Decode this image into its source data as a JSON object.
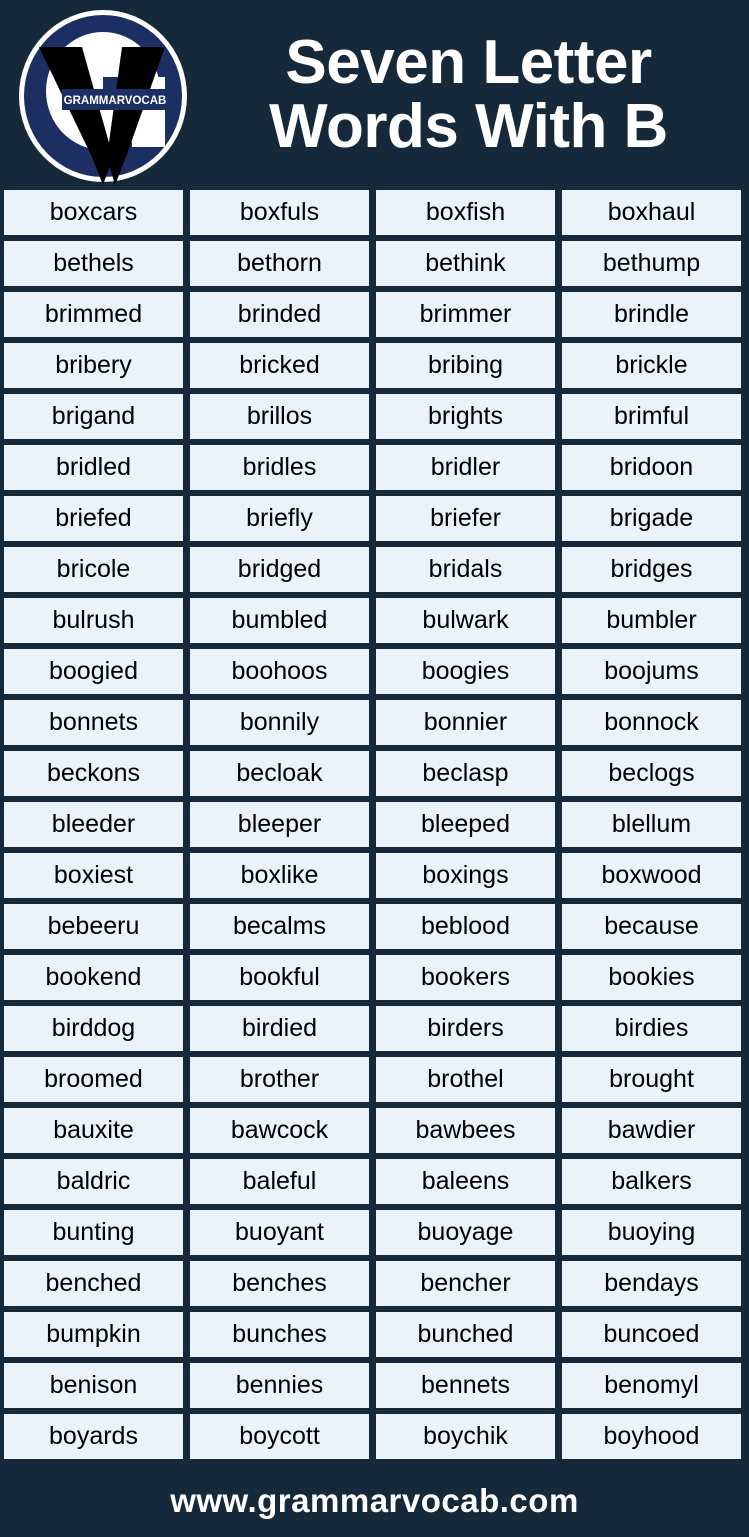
{
  "header": {
    "title_line1": "Seven Letter",
    "title_line2": "Words With B",
    "logo": {
      "brand_text": "GRAMMARVOCAB",
      "letter_g": "G",
      "letter_v": "V"
    }
  },
  "colors": {
    "background": "#16293a",
    "cell_background": "#e9f3f9",
    "cell_text": "#000000",
    "title_text": "#ffffff",
    "logo_navy": "#1b2f63",
    "logo_black": "#000000",
    "logo_white": "#ffffff",
    "footer_text": "#ffffff"
  },
  "footer": {
    "website": "www.grammarvocab.com"
  },
  "grid": {
    "columns": 4,
    "rows": [
      [
        "boxcars",
        "boxfuls",
        "boxfish",
        "boxhaul"
      ],
      [
        "bethels",
        "bethorn",
        "bethink",
        "bethump"
      ],
      [
        "brimmed",
        "brinded",
        "brimmer",
        "brindle"
      ],
      [
        "bribery",
        "bricked",
        "bribing",
        "brickle"
      ],
      [
        "brigand",
        "brillos",
        "brights",
        "brimful"
      ],
      [
        "bridled",
        "bridles",
        "bridler",
        "bridoon"
      ],
      [
        "briefed",
        "briefly",
        "briefer",
        "brigade"
      ],
      [
        "bricole",
        "bridged",
        "bridals",
        "bridges"
      ],
      [
        "bulrush",
        "bumbled",
        "bulwark",
        "bumbler"
      ],
      [
        "boogied",
        "boohoos",
        "boogies",
        "boojums"
      ],
      [
        "bonnets",
        "bonnily",
        "bonnier",
        "bonnock"
      ],
      [
        "beckons",
        "becloak",
        "beclasp",
        "beclogs"
      ],
      [
        "bleeder",
        "bleeper",
        "bleeped",
        "blellum"
      ],
      [
        "boxiest",
        "boxlike",
        "boxings",
        "boxwood"
      ],
      [
        "bebeeru",
        "becalms",
        "beblood",
        "because"
      ],
      [
        "bookend",
        "bookful",
        "bookers",
        "bookies"
      ],
      [
        "birddog",
        "birdied",
        "birders",
        "birdies"
      ],
      [
        "broomed",
        "brother",
        "brothel",
        "brought"
      ],
      [
        "bauxite",
        "bawcock",
        "bawbees",
        "bawdier"
      ],
      [
        "baldric",
        "baleful",
        "baleens",
        "balkers"
      ],
      [
        "bunting",
        "buoyant",
        "buoyage",
        "buoying"
      ],
      [
        "benched",
        "benches",
        "bencher",
        "bendays"
      ],
      [
        "bumpkin",
        "bunches",
        "bunched",
        "buncoed"
      ],
      [
        "benison",
        "bennies",
        "bennets",
        "benomyl"
      ],
      [
        "boyards",
        "boycott",
        "boychik",
        "boyhood"
      ]
    ]
  }
}
